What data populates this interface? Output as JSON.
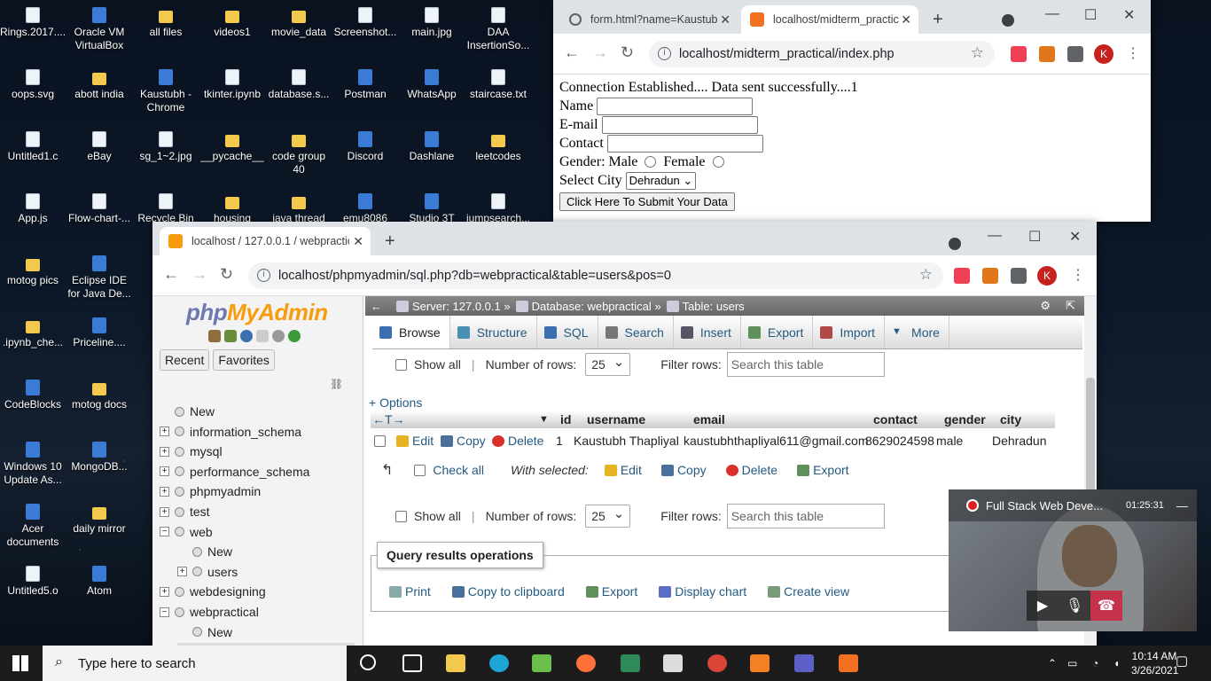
{
  "desktop": {
    "icons": [
      {
        "label": "Rings.2017....",
        "kind": "file"
      },
      {
        "label": "Oracle VM VirtualBox",
        "kind": "app"
      },
      {
        "label": "all files",
        "kind": "folder"
      },
      {
        "label": "videos1",
        "kind": "folder"
      },
      {
        "label": "movie_data",
        "kind": "folder"
      },
      {
        "label": "Screenshot...",
        "kind": "file"
      },
      {
        "label": "main.jpg",
        "kind": "file"
      },
      {
        "label": "DAA InsertionSo...",
        "kind": "file"
      },
      {
        "label": "oops.svg",
        "kind": "file"
      },
      {
        "label": "abott india",
        "kind": "folder"
      },
      {
        "label": "Kaustubh - Chrome",
        "kind": "app"
      },
      {
        "label": "tkinter.ipynb",
        "kind": "file"
      },
      {
        "label": "database.s...",
        "kind": "file"
      },
      {
        "label": "Postman",
        "kind": "app"
      },
      {
        "label": "WhatsApp",
        "kind": "app"
      },
      {
        "label": "staircase.txt",
        "kind": "file"
      },
      {
        "label": "Untitled1.c",
        "kind": "file"
      },
      {
        "label": "eBay",
        "kind": "file"
      },
      {
        "label": "sg_1~2.jpg",
        "kind": "file"
      },
      {
        "label": "__pycache__",
        "kind": "folder"
      },
      {
        "label": "code group 40",
        "kind": "folder"
      },
      {
        "label": "Discord",
        "kind": "app"
      },
      {
        "label": "Dashlane",
        "kind": "app"
      },
      {
        "label": "leetcodes",
        "kind": "folder"
      },
      {
        "label": "App.js",
        "kind": "file"
      },
      {
        "label": "Flow-chart-...",
        "kind": "file"
      },
      {
        "label": "Recycle Bin",
        "kind": "file"
      },
      {
        "label": "housing",
        "kind": "folder"
      },
      {
        "label": "java thread",
        "kind": "folder"
      },
      {
        "label": "emu8086",
        "kind": "app"
      },
      {
        "label": "Studio 3T",
        "kind": "app"
      },
      {
        "label": "jumpsearch...",
        "kind": "file"
      },
      {
        "label": "motog pics",
        "kind": "folder"
      },
      {
        "label": "Eclipse IDE for Java De...",
        "kind": "app"
      },
      {
        "label": ".ipynb_che...",
        "kind": "folder"
      },
      {
        "label": "Priceline....",
        "kind": "app"
      },
      {
        "label": "mo",
        "kind": "file"
      },
      {
        "label": "CodeBlocks",
        "kind": "app"
      },
      {
        "label": "motog docs",
        "kind": "folder"
      },
      {
        "label": "Visu",
        "kind": "app"
      },
      {
        "label": "Windows 10 Update As...",
        "kind": "app"
      },
      {
        "label": "MongoDB...",
        "kind": "app"
      },
      {
        "label": "pr",
        "kind": "file"
      },
      {
        "label": "Acer documents",
        "kind": "app"
      },
      {
        "label": "daily mirror",
        "kind": "folder"
      },
      {
        "label": "d",
        "kind": "file"
      },
      {
        "label": "Untitled5.o",
        "kind": "file"
      },
      {
        "label": "Atom",
        "kind": "app"
      },
      {
        "label": "M",
        "kind": "file"
      }
    ]
  },
  "browser1": {
    "tab1": "form.html?name=Kaustub",
    "tab2": "localhost/midterm_practic",
    "url": "localhost/midterm_practical/index.php",
    "avatar": "K",
    "page": {
      "message": "Connection Established.... Data sent successfully....1",
      "name_label": "Name",
      "email_label": "E-mail",
      "contact_label": "Contact",
      "gender_label": "Gender: Male",
      "female_label": "Female",
      "city_label": "Select City",
      "city_value": "Dehradun",
      "submit": "Click Here To Submit Your Data"
    }
  },
  "browser2": {
    "tab": "localhost / 127.0.0.1 / webpractic",
    "url": "localhost/phpmyadmin/sql.php?db=webpractical&table=users&pos=0",
    "avatar": "K",
    "nav": {
      "logo_php": "php",
      "logo_my": "MyAdmin",
      "recent": "Recent",
      "favorites": "Favorites",
      "tree": [
        "New",
        "information_schema",
        "mysql",
        "performance_schema",
        "phpmyadmin",
        "test",
        "web",
        "New",
        "users",
        "webdesigning",
        "webpractical",
        "New",
        "users"
      ]
    },
    "breadcrumb": {
      "server": "Server: 127.0.0.1 »",
      "database": "Database: webpractical »",
      "table": "Table: users"
    },
    "menu": [
      "Browse",
      "Structure",
      "SQL",
      "Search",
      "Insert",
      "Export",
      "Import",
      "More"
    ],
    "controls": {
      "show_all": "Show all",
      "rows_label": "Number of rows:",
      "rows_value": "25",
      "filter_label": "Filter rows:",
      "filter_placeholder": "Search this table",
      "options": "+ Options"
    },
    "table": {
      "columns": [
        "id",
        "username",
        "email",
        "contact",
        "gender",
        "city"
      ],
      "row": {
        "edit": "Edit",
        "copy": "Copy",
        "delete": "Delete",
        "id": "1",
        "username": "Kaustubh Thapliyal",
        "email": "kaustubhthapliyal611@gmail.com",
        "contact": "8629024598",
        "gender": "male",
        "city": "Dehradun"
      }
    },
    "bulk": {
      "check_all": "Check all",
      "with_selected": "With selected:",
      "edit": "Edit",
      "copy": "Copy",
      "delete": "Delete",
      "export": "Export"
    },
    "qro": {
      "title": "Query results operations",
      "print": "Print",
      "clipboard": "Copy to clipboard",
      "export": "Export",
      "chart": "Display chart",
      "view": "Create view"
    }
  },
  "video": {
    "title": "Full Stack Web Deve...",
    "time": "01:25:31"
  },
  "taskbar": {
    "search": "Type here to search",
    "time": "10:14 AM",
    "date": "3/26/2021"
  }
}
